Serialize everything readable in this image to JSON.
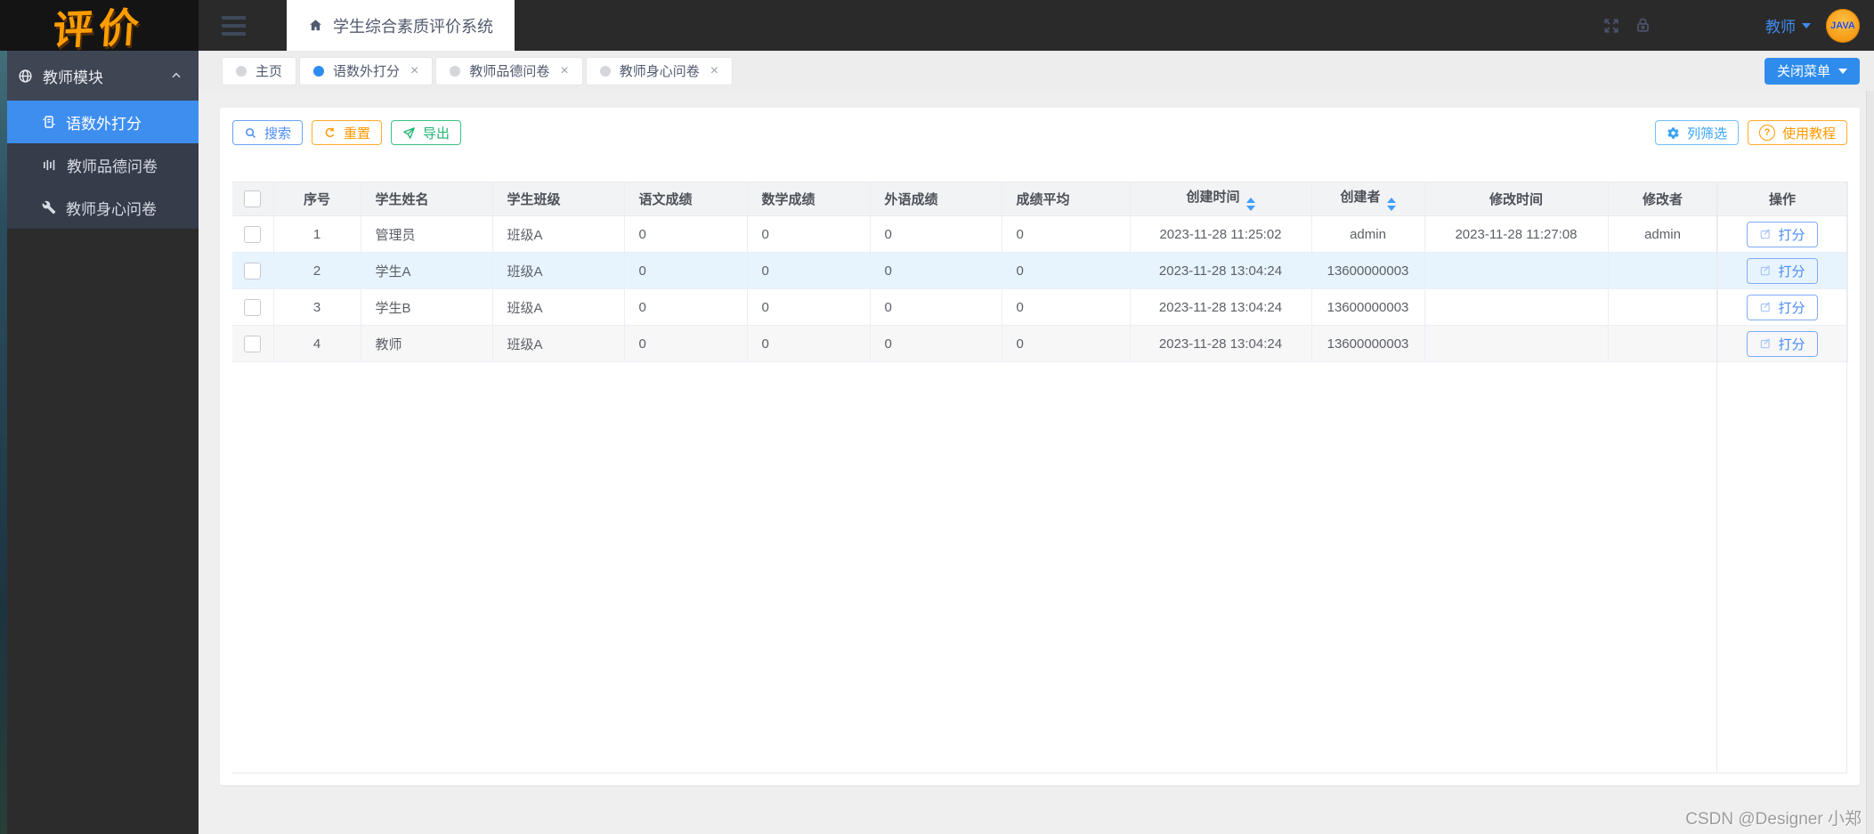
{
  "logo": {
    "text": "评价"
  },
  "header": {
    "app_title": "学生综合素质评价系统",
    "user_menu": {
      "label": "教师"
    },
    "avatar": {
      "text": "JAVA"
    }
  },
  "sidebar": {
    "module": {
      "label": "教师模块"
    },
    "items": [
      {
        "label": "语数外打分",
        "icon": "book-icon",
        "active": true
      },
      {
        "label": "教师品德问卷",
        "icon": "poll-icon",
        "active": false
      },
      {
        "label": "教师身心问卷",
        "icon": "wrench-icon",
        "active": false
      }
    ]
  },
  "tabbar": {
    "tabs": [
      {
        "label": "主页",
        "active": false,
        "closable": false
      },
      {
        "label": "语数外打分",
        "active": true,
        "closable": true
      },
      {
        "label": "教师品德问卷",
        "active": false,
        "closable": true
      },
      {
        "label": "教师身心问卷",
        "active": false,
        "closable": true
      }
    ],
    "close_menu": {
      "label": "关闭菜单"
    }
  },
  "toolbar": {
    "search": "搜索",
    "reset": "重置",
    "export": "导出",
    "column_filter": "列筛选",
    "tutorial": "使用教程"
  },
  "table": {
    "columns": [
      {
        "label": "序号"
      },
      {
        "label": "学生姓名"
      },
      {
        "label": "学生班级"
      },
      {
        "label": "语文成绩"
      },
      {
        "label": "数学成绩"
      },
      {
        "label": "外语成绩"
      },
      {
        "label": "成绩平均"
      },
      {
        "label": "创建时间",
        "sortable": true
      },
      {
        "label": "创建者",
        "sortable": true
      },
      {
        "label": "修改时间"
      },
      {
        "label": "修改者"
      },
      {
        "label": "操作"
      }
    ],
    "action_label": "打分",
    "rows": [
      {
        "cells": [
          "1",
          "管理员",
          "班级A",
          "0",
          "0",
          "0",
          "0",
          "2023-11-28 11:25:02",
          "admin",
          "2023-11-28 11:27:08",
          "admin"
        ],
        "highlight": null
      },
      {
        "cells": [
          "2",
          "学生A",
          "班级A",
          "0",
          "0",
          "0",
          "0",
          "2023-11-28 13:04:24",
          "13600000003",
          "",
          ""
        ],
        "highlight": "blue"
      },
      {
        "cells": [
          "3",
          "学生B",
          "班级A",
          "0",
          "0",
          "0",
          "0",
          "2023-11-28 13:04:24",
          "13600000003",
          "",
          ""
        ],
        "highlight": null
      },
      {
        "cells": [
          "4",
          "教师",
          "班级A",
          "0",
          "0",
          "0",
          "0",
          "2023-11-28 13:04:24",
          "13600000003",
          "",
          ""
        ],
        "highlight": "gray"
      }
    ]
  },
  "footer": {
    "watermark": "CSDN @Designer 小郑"
  },
  "colors": {
    "accent_blue": "#2d8cf0",
    "sidebar_active": "#3e8ef0",
    "orange": "#ff9900",
    "green": "#21b573",
    "sky_blue": "#36a3f7",
    "logo_orange": "#ff9d00",
    "row_highlight_blue": "#e8f4fd",
    "row_stripe_gray": "#f7f7f8"
  }
}
